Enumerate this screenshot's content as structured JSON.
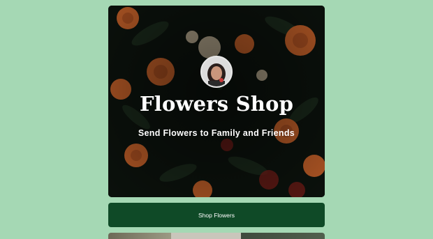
{
  "hero": {
    "title": "Flowers Shop",
    "subtitle": "Send Flowers to Family and Friends"
  },
  "button": {
    "label": "Shop Flowers"
  },
  "colors": {
    "background": "#a5d8b4",
    "button": "#0f4a27",
    "text": "#ffffff"
  }
}
